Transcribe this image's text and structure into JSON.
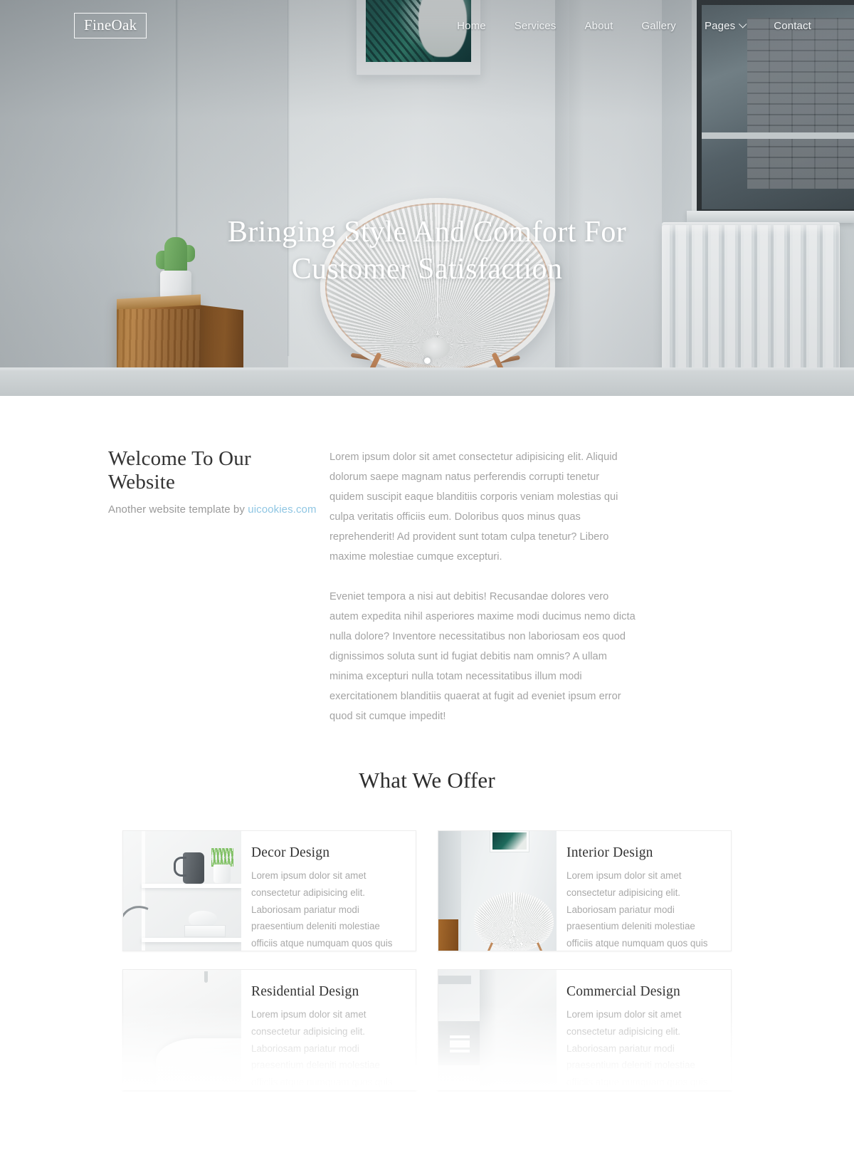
{
  "header": {
    "logo": "FineOak",
    "nav": [
      {
        "label": "Home",
        "has_dropdown": false
      },
      {
        "label": "Services",
        "has_dropdown": false
      },
      {
        "label": "About",
        "has_dropdown": false
      },
      {
        "label": "Gallery",
        "has_dropdown": false
      },
      {
        "label": "Pages",
        "has_dropdown": true
      },
      {
        "label": "Contact",
        "has_dropdown": false
      }
    ]
  },
  "hero": {
    "title_line1": "Bringing Style And Comfort For",
    "title_line2": "Customer Satisfaction",
    "slides": 1
  },
  "welcome": {
    "title": "Welcome To Our Website",
    "subtitle_prefix": "Another website template by ",
    "subtitle_link": "uicookies.com",
    "paragraph1": "Lorem ipsum dolor sit amet consectetur adipisicing elit. Aliquid dolorum saepe magnam natus perferendis corrupti tenetur quidem suscipit eaque blanditiis corporis veniam molestias qui culpa veritatis officiis eum. Doloribus quos minus quas reprehenderit! Ad provident sunt totam culpa tenetur? Libero maxime molestiae cumque excepturi.",
    "paragraph2": "Eveniet tempora a nisi aut debitis! Recusandae dolores vero autem expedita nihil asperiores maxime modi ducimus nemo dicta nulla dolore? Inventore necessitatibus non laboriosam eos quod dignissimos soluta sunt id fugiat debitis nam omnis? A ullam minima excepturi nulla totam necessitatibus illum modi exercitationem blanditiis quaerat at fugit ad eveniet ipsum error quod sit cumque impedit!"
  },
  "offers": {
    "title": "What We Offer",
    "cards": [
      {
        "title": "Decor Design",
        "text": "Lorem ipsum dolor sit amet consectetur adipisicing elit. Laboriosam pariatur modi praesentium deleniti molestiae officiis atque numquam quos quis nisi voluptatum architecto rerum error.",
        "thumb": "shelf-with-pitcher-photo"
      },
      {
        "title": "Interior Design",
        "text": "Lorem ipsum dolor sit amet consectetur adipisicing elit. Laboriosam pariatur modi praesentium deleniti molestiae officiis atque numquam quos quis nisi voluptatum architecto rerum error.",
        "thumb": "room-with-round-chair-photo"
      },
      {
        "title": "Residential Design",
        "text": "Lorem ipsum dolor sit amet consectetur adipisicing elit. Laboriosam pariatur modi praesentium deleniti molestiae officiis atque numquam quos quis nisi",
        "thumb": "white-bathroom-photo"
      },
      {
        "title": "Commercial Design",
        "text": "Lorem ipsum dolor sit amet consectetur adipisicing elit. Laboriosam pariatur modi praesentium deleniti molestiae officiis atque numquam quos quis nisi",
        "thumb": "wall-with-sign-photo"
      }
    ]
  },
  "colors": {
    "link_accent": "#8fc6e3",
    "heading": "#333333",
    "body_text": "#a3a3a3",
    "card_border": "#ededed",
    "page_background": "#ffffff"
  }
}
